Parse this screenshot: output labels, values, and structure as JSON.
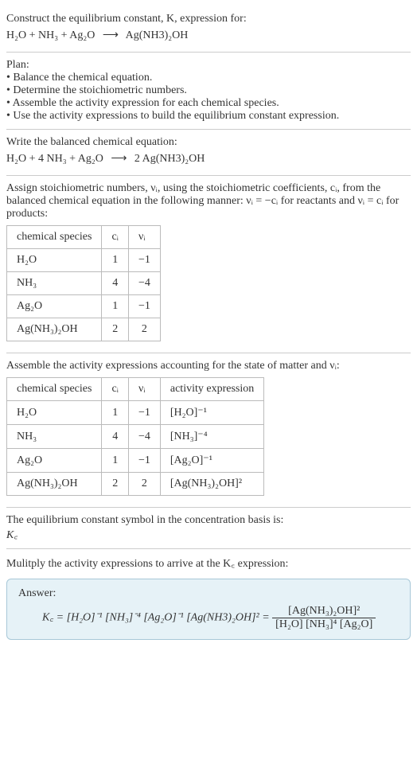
{
  "header": {
    "line1": "Construct the equilibrium constant, K, expression for:",
    "equation_lhs": "H₂O + NH₃ + Ag₂O",
    "arrow": "⟶",
    "equation_rhs": "Ag(NH3)₂OH"
  },
  "plan": {
    "title": "Plan:",
    "b1": "• Balance the chemical equation.",
    "b2": "• Determine the stoichiometric numbers.",
    "b3": "• Assemble the activity expression for each chemical species.",
    "b4": "• Use the activity expressions to build the equilibrium constant expression."
  },
  "balanced": {
    "title": "Write the balanced chemical equation:",
    "lhs": "H₂O + 4 NH₃ + Ag₂O",
    "arrow": "⟶",
    "rhs": "2 Ag(NH3)₂OH"
  },
  "stoich": {
    "intro1": "Assign stoichiometric numbers, νᵢ, using the stoichiometric coefficients, cᵢ, from the balanced chemical equation in the following manner: νᵢ = −cᵢ for reactants and νᵢ = cᵢ for products:",
    "headers": {
      "species": "chemical species",
      "c": "cᵢ",
      "v": "νᵢ"
    },
    "rows": [
      {
        "species": "H₂O",
        "c": "1",
        "v": "−1"
      },
      {
        "species": "NH₃",
        "c": "4",
        "v": "−4"
      },
      {
        "species": "Ag₂O",
        "c": "1",
        "v": "−1"
      },
      {
        "species": "Ag(NH₃)₂OH",
        "c": "2",
        "v": "2"
      }
    ]
  },
  "activity": {
    "intro": "Assemble the activity expressions accounting for the state of matter and νᵢ:",
    "headers": {
      "species": "chemical species",
      "c": "cᵢ",
      "v": "νᵢ",
      "expr": "activity expression"
    },
    "rows": [
      {
        "species": "H₂O",
        "c": "1",
        "v": "−1",
        "expr": "[H₂O]⁻¹"
      },
      {
        "species": "NH₃",
        "c": "4",
        "v": "−4",
        "expr": "[NH₃]⁻⁴"
      },
      {
        "species": "Ag₂O",
        "c": "1",
        "v": "−1",
        "expr": "[Ag₂O]⁻¹"
      },
      {
        "species": "Ag(NH₃)₂OH",
        "c": "2",
        "v": "2",
        "expr": "[Ag(NH₃)₂OH]²"
      }
    ]
  },
  "symbol": {
    "line1": "The equilibrium constant symbol in the concentration basis is:",
    "kc": "K꜀"
  },
  "multiply": {
    "line1": "Mulitply the activity expressions to arrive at the K꜀ expression:"
  },
  "answer": {
    "label": "Answer:",
    "lhs": "K꜀ = [H₂O]⁻¹ [NH₃]⁻⁴ [Ag₂O]⁻¹ [Ag(NH3)₂OH]² =",
    "num": "[Ag(NH₃)₂OH]²",
    "den": "[H₂O] [NH₃]⁴ [Ag₂O]"
  },
  "chart_data": {
    "type": "table",
    "tables": [
      {
        "title": "Stoichiometric numbers",
        "columns": [
          "chemical species",
          "c_i",
          "ν_i"
        ],
        "rows": [
          [
            "H2O",
            1,
            -1
          ],
          [
            "NH3",
            4,
            -4
          ],
          [
            "Ag2O",
            1,
            -1
          ],
          [
            "Ag(NH3)2OH",
            2,
            2
          ]
        ]
      },
      {
        "title": "Activity expressions",
        "columns": [
          "chemical species",
          "c_i",
          "ν_i",
          "activity expression"
        ],
        "rows": [
          [
            "H2O",
            1,
            -1,
            "[H2O]^-1"
          ],
          [
            "NH3",
            4,
            -4,
            "[NH3]^-4"
          ],
          [
            "Ag2O",
            1,
            -1,
            "[Ag2O]^-1"
          ],
          [
            "Ag(NH3)2OH",
            2,
            2,
            "[Ag(NH3)2OH]^2"
          ]
        ]
      }
    ],
    "balanced_equation": "H2O + 4 NH3 + Ag2O -> 2 Ag(NH3)2OH",
    "Kc_expression": "[Ag(NH3)2OH]^2 / ([H2O] [NH3]^4 [Ag2O])"
  }
}
